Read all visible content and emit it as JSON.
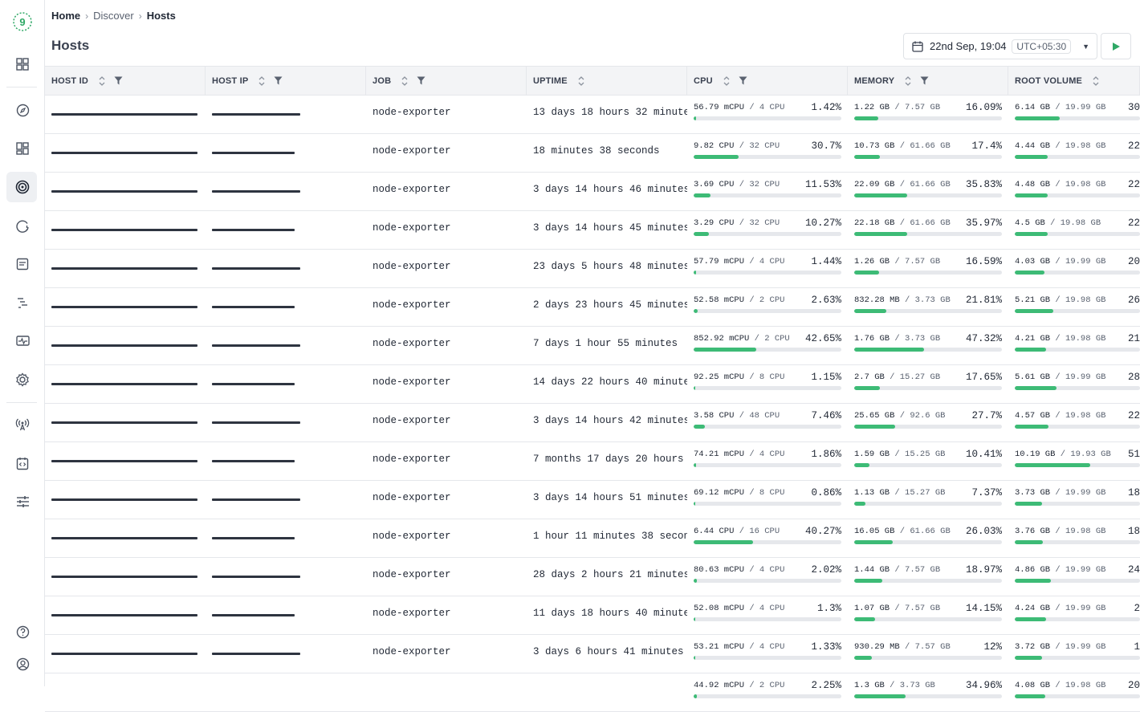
{
  "breadcrumb": {
    "home": "Home",
    "discover": "Discover",
    "current": "Hosts"
  },
  "page_title": "Hosts",
  "time_picker": {
    "date": "22nd Sep, 19:04",
    "timezone": "UTC+05:30"
  },
  "columns": [
    "HOST ID",
    "HOST IP",
    "JOB",
    "UPTIME",
    "CPU",
    "MEMORY",
    "ROOT VOLUME"
  ],
  "colors": {
    "accent": "#3dbb76",
    "logo": "#2fa866"
  },
  "icons": [
    "logo-icon",
    "dashboard-icon",
    "compass-icon",
    "apps-icon",
    "target-icon",
    "alert-icon",
    "logs-icon",
    "traces-icon",
    "monitor-icon",
    "settings-icon",
    "broadcast-icon",
    "code-icon",
    "sliders-icon",
    "help-icon",
    "user-icon",
    "calendar-icon",
    "play-icon"
  ],
  "rows": [
    {
      "job": "node-exporter",
      "uptime": "13 days 18 hours 32 minutes",
      "cpu_used": "56.79 mCPU",
      "cpu_total": "/ 4 CPU",
      "cpu_pct": "1.42%",
      "mem_used": "1.22 GB",
      "mem_total": "/ 7.57 GB",
      "mem_pct": "16.09%",
      "root_used": "6.14 GB",
      "root_total": "/ 19.99 GB",
      "root_pct": "30",
      "cpu_frac": 0.0142,
      "mem_frac": 0.1609,
      "root_frac": 0.307
    },
    {
      "job": "node-exporter",
      "uptime": "18 minutes 38 seconds",
      "cpu_used": "9.82 CPU",
      "cpu_total": "/ 32 CPU",
      "cpu_pct": "30.7%",
      "mem_used": "10.73 GB",
      "mem_total": "/ 61.66 GB",
      "mem_pct": "17.4%",
      "root_used": "4.44 GB",
      "root_total": "/ 19.98 GB",
      "root_pct": "22",
      "cpu_frac": 0.307,
      "mem_frac": 0.174,
      "root_frac": 0.222
    },
    {
      "job": "node-exporter",
      "uptime": "3 days 14 hours 46 minutes",
      "cpu_used": "3.69 CPU",
      "cpu_total": "/ 32 CPU",
      "cpu_pct": "11.53%",
      "mem_used": "22.09 GB",
      "mem_total": "/ 61.66 GB",
      "mem_pct": "35.83%",
      "root_used": "4.48 GB",
      "root_total": "/ 19.98 GB",
      "root_pct": "22",
      "cpu_frac": 0.1153,
      "mem_frac": 0.3583,
      "root_frac": 0.224
    },
    {
      "job": "node-exporter",
      "uptime": "3 days 14 hours 45 minutes",
      "cpu_used": "3.29 CPU",
      "cpu_total": "/ 32 CPU",
      "cpu_pct": "10.27%",
      "mem_used": "22.18 GB",
      "mem_total": "/ 61.66 GB",
      "mem_pct": "35.97%",
      "root_used": "4.5 GB",
      "root_total": "/ 19.98 GB",
      "root_pct": "22",
      "cpu_frac": 0.1027,
      "mem_frac": 0.3597,
      "root_frac": 0.225
    },
    {
      "job": "node-exporter",
      "uptime": "23 days 5 hours 48 minutes",
      "cpu_used": "57.79 mCPU",
      "cpu_total": "/ 4 CPU",
      "cpu_pct": "1.44%",
      "mem_used": "1.26 GB",
      "mem_total": "/ 7.57 GB",
      "mem_pct": "16.59%",
      "root_used": "4.03 GB",
      "root_total": "/ 19.99 GB",
      "root_pct": "20",
      "cpu_frac": 0.0144,
      "mem_frac": 0.1659,
      "root_frac": 0.202
    },
    {
      "job": "node-exporter",
      "uptime": "2 days 23 hours 45 minutes",
      "cpu_used": "52.58 mCPU",
      "cpu_total": "/ 2 CPU",
      "cpu_pct": "2.63%",
      "mem_used": "832.28 MB",
      "mem_total": "/ 3.73 GB",
      "mem_pct": "21.81%",
      "root_used": "5.21 GB",
      "root_total": "/ 19.98 GB",
      "root_pct": "26",
      "cpu_frac": 0.0263,
      "mem_frac": 0.2181,
      "root_frac": 0.261
    },
    {
      "job": "node-exporter",
      "uptime": "7 days 1 hour 55 minutes",
      "cpu_used": "852.92 mCPU",
      "cpu_total": "/ 2 CPU",
      "cpu_pct": "42.65%",
      "mem_used": "1.76 GB",
      "mem_total": "/ 3.73 GB",
      "mem_pct": "47.32%",
      "root_used": "4.21 GB",
      "root_total": "/ 19.98 GB",
      "root_pct": "21",
      "cpu_frac": 0.4265,
      "mem_frac": 0.4732,
      "root_frac": 0.211
    },
    {
      "job": "node-exporter",
      "uptime": "14 days 22 hours 40 minutes",
      "cpu_used": "92.25 mCPU",
      "cpu_total": "/ 8 CPU",
      "cpu_pct": "1.15%",
      "mem_used": "2.7 GB",
      "mem_total": "/ 15.27 GB",
      "mem_pct": "17.65%",
      "root_used": "5.61 GB",
      "root_total": "/ 19.99 GB",
      "root_pct": "28",
      "cpu_frac": 0.0115,
      "mem_frac": 0.1765,
      "root_frac": 0.281
    },
    {
      "job": "node-exporter",
      "uptime": "3 days 14 hours 42 minutes",
      "cpu_used": "3.58 CPU",
      "cpu_total": "/ 48 CPU",
      "cpu_pct": "7.46%",
      "mem_used": "25.65 GB",
      "mem_total": "/ 92.6 GB",
      "mem_pct": "27.7%",
      "root_used": "4.57 GB",
      "root_total": "/ 19.98 GB",
      "root_pct": "22",
      "cpu_frac": 0.0746,
      "mem_frac": 0.277,
      "root_frac": 0.229
    },
    {
      "job": "node-exporter",
      "uptime": "7 months 17 days 20 hours",
      "cpu_used": "74.21 mCPU",
      "cpu_total": "/ 4 CPU",
      "cpu_pct": "1.86%",
      "mem_used": "1.59 GB",
      "mem_total": "/ 15.25 GB",
      "mem_pct": "10.41%",
      "root_used": "10.19 GB",
      "root_total": "/ 19.93 GB",
      "root_pct": "51",
      "cpu_frac": 0.0186,
      "mem_frac": 0.1041,
      "root_frac": 0.511
    },
    {
      "job": "node-exporter",
      "uptime": "3 days 14 hours 51 minutes",
      "cpu_used": "69.12 mCPU",
      "cpu_total": "/ 8 CPU",
      "cpu_pct": "0.86%",
      "mem_used": "1.13 GB",
      "mem_total": "/ 15.27 GB",
      "mem_pct": "7.37%",
      "root_used": "3.73 GB",
      "root_total": "/ 19.99 GB",
      "root_pct": "18",
      "cpu_frac": 0.0086,
      "mem_frac": 0.0737,
      "root_frac": 0.187
    },
    {
      "job": "node-exporter",
      "uptime": "1 hour 11 minutes 38 seconds",
      "cpu_used": "6.44 CPU",
      "cpu_total": "/ 16 CPU",
      "cpu_pct": "40.27%",
      "mem_used": "16.05 GB",
      "mem_total": "/ 61.66 GB",
      "mem_pct": "26.03%",
      "root_used": "3.76 GB",
      "root_total": "/ 19.98 GB",
      "root_pct": "18",
      "cpu_frac": 0.4027,
      "mem_frac": 0.2603,
      "root_frac": 0.188
    },
    {
      "job": "node-exporter",
      "uptime": "28 days 2 hours 21 minutes",
      "cpu_used": "80.63 mCPU",
      "cpu_total": "/ 4 CPU",
      "cpu_pct": "2.02%",
      "mem_used": "1.44 GB",
      "mem_total": "/ 7.57 GB",
      "mem_pct": "18.97%",
      "root_used": "4.86 GB",
      "root_total": "/ 19.99 GB",
      "root_pct": "24",
      "cpu_frac": 0.0202,
      "mem_frac": 0.1897,
      "root_frac": 0.243
    },
    {
      "job": "node-exporter",
      "uptime": "11 days 18 hours 40 minutes",
      "cpu_used": "52.08 mCPU",
      "cpu_total": "/ 4 CPU",
      "cpu_pct": "1.3%",
      "mem_used": "1.07 GB",
      "mem_total": "/ 7.57 GB",
      "mem_pct": "14.15%",
      "root_used": "4.24 GB",
      "root_total": "/ 19.99 GB",
      "root_pct": "2",
      "cpu_frac": 0.013,
      "mem_frac": 0.1415,
      "root_frac": 0.212
    },
    {
      "job": "node-exporter",
      "uptime": "3 days 6 hours 41 minutes",
      "cpu_used": "53.21 mCPU",
      "cpu_total": "/ 4 CPU",
      "cpu_pct": "1.33%",
      "mem_used": "930.29 MB",
      "mem_total": "/ 7.57 GB",
      "mem_pct": "12%",
      "root_used": "3.72 GB",
      "root_total": "/ 19.99 GB",
      "root_pct": "1",
      "cpu_frac": 0.0133,
      "mem_frac": 0.12,
      "root_frac": 0.186
    },
    {
      "job": "",
      "uptime": "",
      "cpu_used": "44.92 mCPU",
      "cpu_total": "/ 2 CPU",
      "cpu_pct": "2.25%",
      "mem_used": "1.3 GB",
      "mem_total": "/ 3.73 GB",
      "mem_pct": "34.96%",
      "root_used": "4.08 GB",
      "root_total": "/ 19.98 GB",
      "root_pct": "20",
      "cpu_frac": 0.0225,
      "mem_frac": 0.3496,
      "root_frac": 0.204
    }
  ]
}
